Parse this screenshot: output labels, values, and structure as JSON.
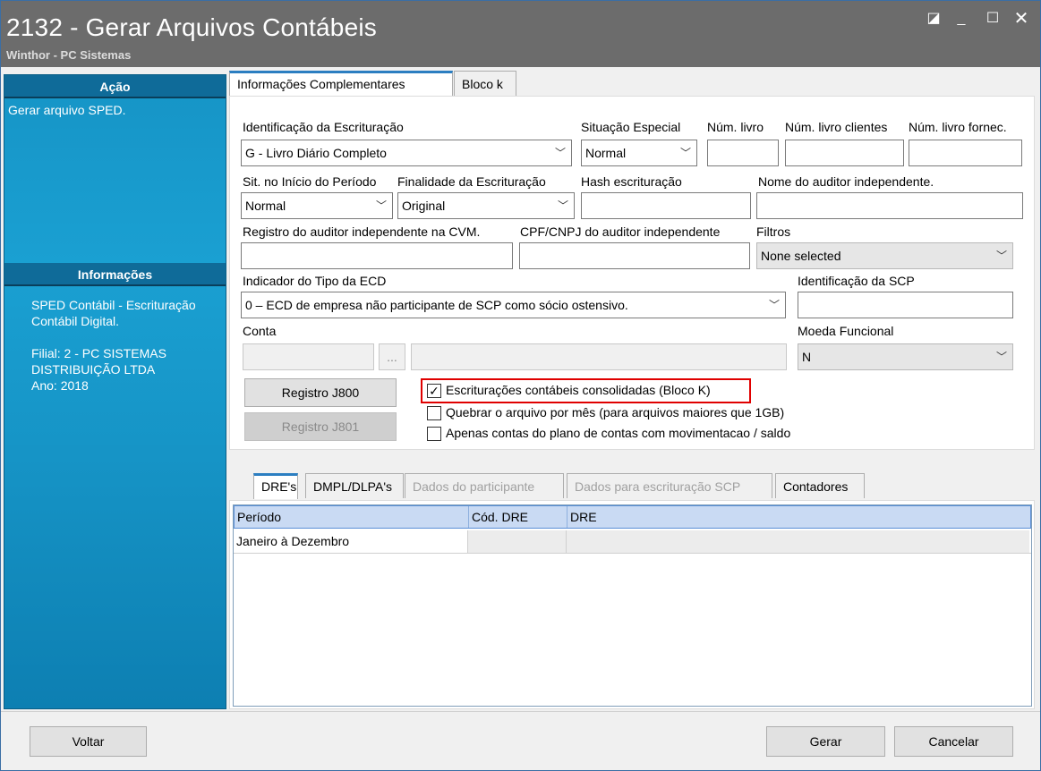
{
  "window": {
    "title": "2132 - Gerar Arquivos Contábeis",
    "subtitle": "Winthor - PC Sistemas"
  },
  "sidebar": {
    "acao_header": "Ação",
    "acao_text": "Gerar arquivo SPED.",
    "info_header": "Informações",
    "info_line1": "SPED Contábil - Escrituração",
    "info_line2": "Contábil Digital.",
    "info_line3": "Filial: 2 - PC SISTEMAS",
    "info_line4": "DISTRIBUIÇÃO LTDA",
    "info_line5": "Ano: 2018"
  },
  "main_tabs": [
    "Informações Complementares",
    "Bloco k"
  ],
  "form": {
    "identificacao_label": "Identificação da Escrituração",
    "identificacao_value": "G - Livro Diário Completo",
    "situacao_label": "Situação Especial",
    "situacao_value": "Normal",
    "num_livro_label": "Núm. livro",
    "num_livro_value": "",
    "num_livro_clientes_label": "Núm. livro clientes",
    "num_livro_clientes_value": "",
    "num_livro_fornec_label": "Núm. livro fornec.",
    "num_livro_fornec_value": "",
    "sit_inicio_label": "Sit. no Início do Período",
    "sit_inicio_value": "Normal",
    "finalidade_label": "Finalidade da Escrituração",
    "finalidade_value": "Original",
    "hash_label": "Hash escrituração",
    "hash_value": "",
    "nome_auditor_label": "Nome do auditor independente.",
    "nome_auditor_value": "",
    "registro_auditor_label": "Registro do auditor independente na CVM.",
    "registro_auditor_value": "",
    "cpf_auditor_label": "CPF/CNPJ do auditor independente",
    "cpf_auditor_value": "",
    "filtros_label": "Filtros",
    "filtros_value": "None selected",
    "indicador_label": "Indicador do Tipo da ECD",
    "indicador_value": "0 – ECD de empresa não participante de SCP como sócio ostensivo.",
    "identificacao_scp_label": "Identificação da SCP",
    "identificacao_scp_value": "",
    "conta_label": "Conta",
    "conta_ellipsis": "...",
    "moeda_label": "Moeda Funcional",
    "moeda_value": "N",
    "btn_j800": "Registro J800",
    "btn_j801": "Registro J801",
    "chk1_label": "Escriturações contábeis consolidadas (Bloco K)",
    "chk1_mark": "✓",
    "chk2_label": "Quebrar o arquivo por mês (para arquivos maiores que 1GB)",
    "chk3_label": "Apenas contas do plano de contas com movimentacao / saldo"
  },
  "sub_tabs": [
    "DRE's",
    "DMPL/DLPA's",
    "Dados do participante",
    "Dados para escrituração SCP",
    "Contadores"
  ],
  "grid": {
    "headers": [
      "Período",
      "Cód. DRE",
      "DRE"
    ],
    "rows": [
      [
        "Janeiro à Dezembro",
        "",
        ""
      ]
    ]
  },
  "footer": {
    "voltar": "Voltar",
    "gerar": "Gerar",
    "cancelar": "Cancelar"
  }
}
